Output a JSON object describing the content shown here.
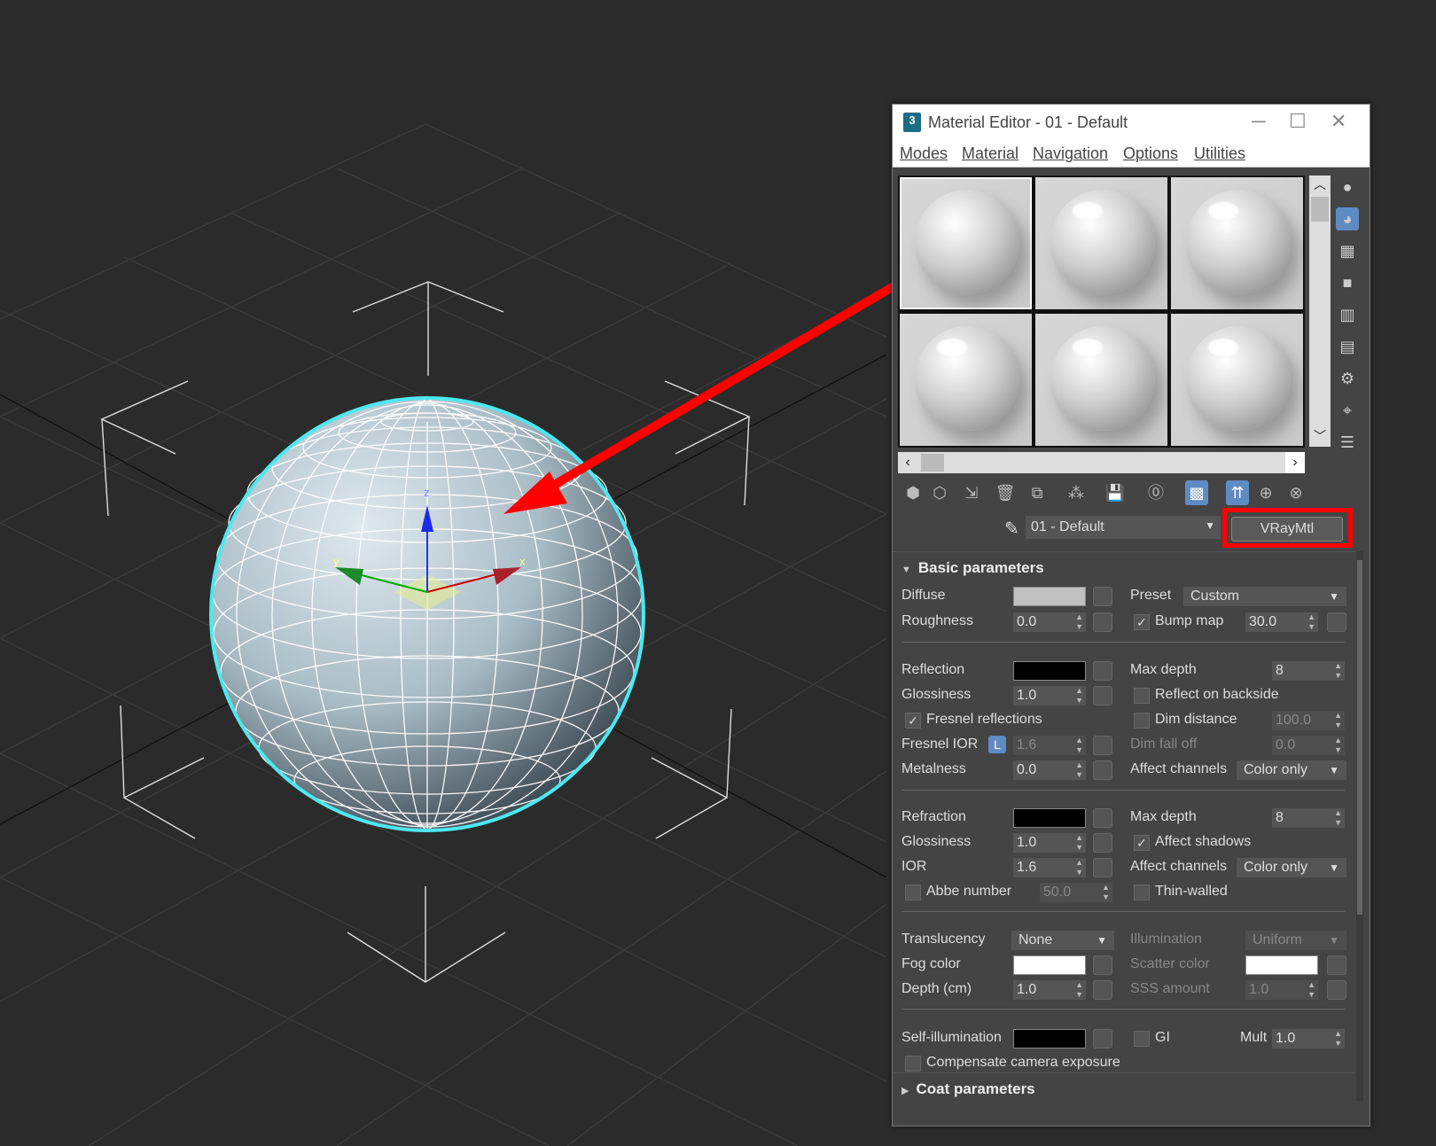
{
  "window": {
    "title": "Material Editor - 01 - Default",
    "app_icon_text": "3"
  },
  "menu": [
    "Modes",
    "Material",
    "Navigation",
    "Options",
    "Utilities"
  ],
  "material": {
    "name": "01 - Default",
    "type": "VRayMtl"
  },
  "basic": {
    "header": "Basic parameters",
    "diffuse": "Diffuse",
    "preset": "Preset",
    "preset_value": "Custom",
    "roughness": "Roughness",
    "roughness_value": "0.0",
    "bump_map": "Bump map",
    "bump_value": "30.0",
    "reflection": "Reflection",
    "max_depth": "Max depth",
    "refl_max_depth": "8",
    "glossiness": "Glossiness",
    "refl_gloss": "1.0",
    "reflect_backside": "Reflect on backside",
    "fresnel": "Fresnel reflections",
    "dim_distance": "Dim distance",
    "dim_distance_value": "100.0",
    "fresnel_ior": "Fresnel IOR",
    "fresnel_ior_lock": "L",
    "fresnel_ior_value": "1.6",
    "dim_falloff": "Dim fall off",
    "dim_falloff_value": "0.0",
    "metalness": "Metalness",
    "metalness_value": "0.0",
    "affect_channels": "Affect channels",
    "affect_channels_value": "Color only",
    "refraction": "Refraction",
    "refr_max_depth": "8",
    "refr_gloss": "1.0",
    "affect_shadows": "Affect shadows",
    "ior": "IOR",
    "ior_value": "1.6",
    "refr_affect_channels_value": "Color only",
    "abbe": "Abbe number",
    "abbe_value": "50.0",
    "thin_walled": "Thin-walled",
    "translucency": "Translucency",
    "translucency_value": "None",
    "illumination": "Illumination",
    "illumination_value": "Uniform",
    "fog_color": "Fog color",
    "scatter_color": "Scatter color",
    "depth": "Depth (cm)",
    "depth_value": "1.0",
    "sss_amount": "SSS amount",
    "sss_value": "1.0",
    "self_illum": "Self-illumination",
    "gi": "GI",
    "mult": "Mult",
    "mult_value": "1.0",
    "compensate": "Compensate camera exposure"
  },
  "coat": {
    "header": "Coat parameters"
  },
  "gizmo": {
    "z": "z",
    "y": "y",
    "x": "x"
  },
  "colors": {
    "selection": "#4de8f0",
    "arrow": "#ff0000",
    "sphere": "#9fb6c0"
  }
}
